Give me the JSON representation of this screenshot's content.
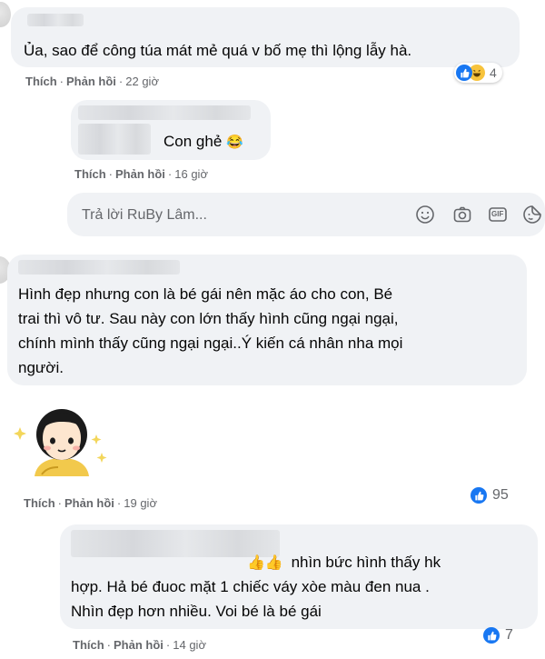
{
  "comments": [
    {
      "text": "Ủa, sao để công túa mát mẻ quá v bố mẹ thì lộng lẫy hà.",
      "actions": {
        "like": "Thích",
        "reply": "Phản hồi",
        "time": "22 giờ"
      },
      "reactions": {
        "types": [
          "like",
          "haha"
        ],
        "count": "4"
      }
    },
    {
      "text": "Con ghẻ",
      "emoji": "😂",
      "actions": {
        "like": "Thích",
        "reply": "Phản hồi",
        "time": "16 giờ"
      }
    },
    {
      "text": "Hình đẹp nhưng con là bé gái nên mặc áo cho con, Bé trai thì vô tư. Sau này con lớn thấy hình cũng ngại ngại, chính mình thấy cũng ngại ngại..Ý kiến cá nhân nha mọi người.",
      "lines": [
        "Hình đẹp nhưng con là bé gái nên mặc áo cho con, Bé",
        "trai thì vô tư. Sau này con lớn thấy hình cũng ngại ngại,",
        "chính mình thấy cũng ngại ngại..Ý kiến cá nhân nha mọi",
        "người."
      ],
      "actions": {
        "like": "Thích",
        "reply": "Phản hồi",
        "time": "19 giờ"
      },
      "reactions": {
        "types": [
          "like"
        ],
        "count": "95"
      }
    },
    {
      "emoji": "👍👍",
      "lines": [
        "nhìn bức hình thấy hk",
        "hợp. Hả bé đuoc mặt 1 chiếc váy xòe màu đen nua .",
        "Nhìn đẹp hơn nhiều. Voi bé là bé gái"
      ],
      "actions": {
        "like": "Thích",
        "reply": "Phản hồi",
        "time": "14 giờ"
      },
      "reactions": {
        "types": [
          "like"
        ],
        "count": "7"
      }
    }
  ],
  "reply_box": {
    "placeholder": "Trả lời RuBy Lâm...",
    "icons": [
      "emoji-icon",
      "camera-icon",
      "gif-icon",
      "sticker-icon"
    ],
    "gif_label": "GIF"
  },
  "colors": {
    "bubble": "#f0f2f5",
    "meta": "#65676b",
    "like": "#1877f2",
    "haha": "#f7c33c"
  }
}
